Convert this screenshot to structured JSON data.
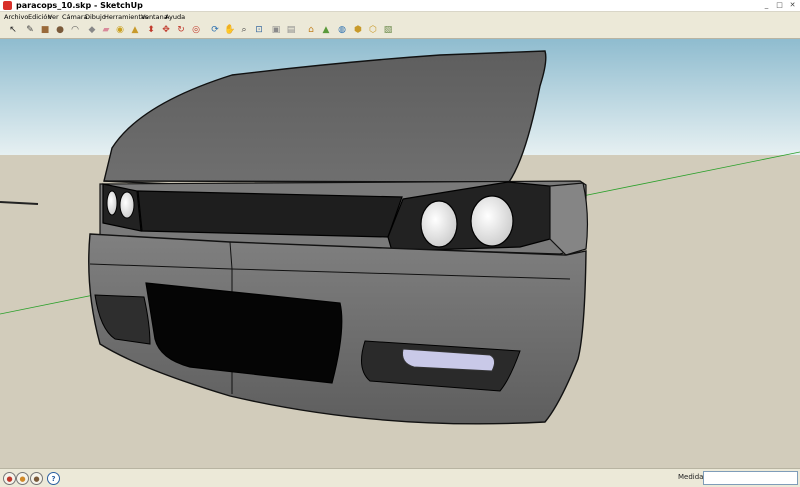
{
  "window": {
    "title": "paracops_10.skp - SketchUp",
    "minimize_glyph": "_",
    "maximize_glyph": "□",
    "close_glyph": "✕"
  },
  "menu": {
    "items": [
      "Archivo",
      "Edición",
      "Ver",
      "Cámara",
      "Dibujo",
      "Herramientas",
      "Ventana",
      "Ayuda"
    ]
  },
  "toolbar": {
    "tools": [
      {
        "name": "select-icon",
        "glyph": "↖",
        "color": "#222222"
      },
      {
        "name": "pencil-icon",
        "glyph": "✎",
        "color": "#444444"
      },
      {
        "name": "rectangle-icon",
        "glyph": "■",
        "color": "#9a6a3a"
      },
      {
        "name": "circle-icon",
        "glyph": "●",
        "color": "#7a5a3a"
      },
      {
        "name": "arc-icon",
        "glyph": "◠",
        "color": "#555555"
      },
      {
        "name": "make-component-icon",
        "glyph": "◆",
        "color": "#888888"
      },
      {
        "name": "eraser-icon",
        "glyph": "▰",
        "color": "#d98a9a"
      },
      {
        "name": "tape-measure-icon",
        "glyph": "◉",
        "color": "#caa020"
      },
      {
        "name": "paint-bucket-icon",
        "glyph": "▲",
        "color": "#c89a2a"
      },
      {
        "name": "push-pull-icon",
        "glyph": "⬍",
        "color": "#c0392b"
      },
      {
        "name": "move-icon",
        "glyph": "✥",
        "color": "#c0392b"
      },
      {
        "name": "rotate-icon",
        "glyph": "↻",
        "color": "#c0392b"
      },
      {
        "name": "offset-icon",
        "glyph": "◎",
        "color": "#c0392b"
      },
      {
        "name": "orbit-icon",
        "glyph": "⟳",
        "color": "#2a6fb0"
      },
      {
        "name": "pan-icon",
        "glyph": "✋",
        "color": "#555555"
      },
      {
        "name": "zoom-icon",
        "glyph": "⌕",
        "color": "#444444"
      },
      {
        "name": "zoom-extents-icon",
        "glyph": "⊡",
        "color": "#3a6aa0"
      },
      {
        "name": "previous-view-icon",
        "glyph": "▣",
        "color": "#8a8a8a"
      },
      {
        "name": "next-view-icon",
        "glyph": "▤",
        "color": "#8a8a8a"
      },
      {
        "name": "add-location-icon",
        "glyph": "⌂",
        "color": "#c08020"
      },
      {
        "name": "toggle-terrain-icon",
        "glyph": "▲",
        "color": "#5a9a3a"
      },
      {
        "name": "google-earth-icon",
        "glyph": "◍",
        "color": "#2a6fb0"
      },
      {
        "name": "3d-warehouse-icon",
        "glyph": "⬢",
        "color": "#c89a2a"
      },
      {
        "name": "share-model-icon",
        "glyph": "⬡",
        "color": "#c89a2a"
      },
      {
        "name": "get-models-icon",
        "glyph": "▧",
        "color": "#6a8a4a"
      }
    ]
  },
  "status": {
    "icons": [
      {
        "name": "geo-location-icon",
        "glyph": "●",
        "color": "#c0392b"
      },
      {
        "name": "credits-icon",
        "glyph": "●",
        "color": "#d08a2a"
      },
      {
        "name": "user-icon",
        "glyph": "●",
        "color": "#7a5a3a"
      },
      {
        "name": "help-icon",
        "glyph": "?",
        "color": "#2a5fa0"
      }
    ],
    "measurements_label": "Medidas",
    "measurements_value": ""
  },
  "colors": {
    "sky_top": "#8fbccf",
    "sky_bottom": "#e6f0f2",
    "ground": "#d2ccbb",
    "model_gray": "#6d6d6d",
    "green_axis": "#2aa02a"
  }
}
